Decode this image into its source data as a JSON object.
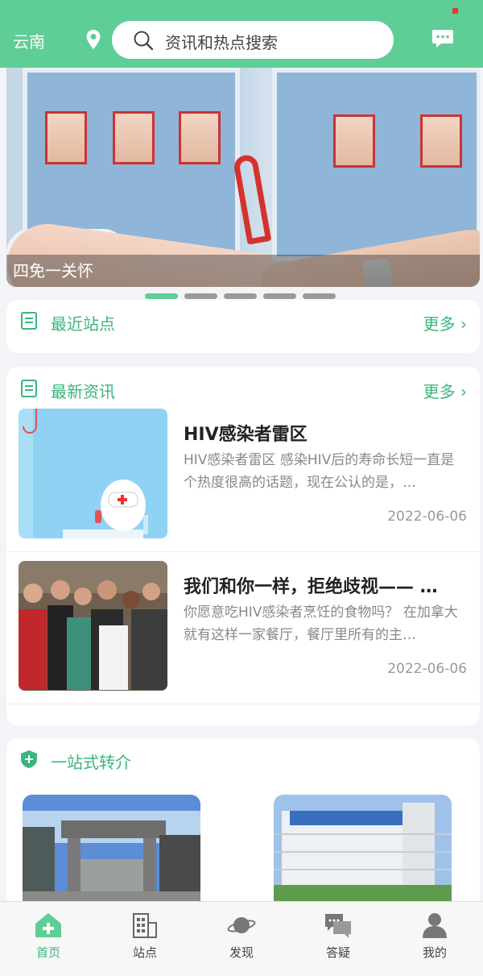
{
  "header": {
    "city": "云南",
    "search_placeholder": "资讯和热点搜索",
    "icons": [
      "location-pin-icon",
      "search-icon",
      "message-icon"
    ]
  },
  "banner": {
    "caption": "四免一关怀",
    "slides_total": 5,
    "active_index": 0
  },
  "recent_stations": {
    "title": "最近站点",
    "more": "更多"
  },
  "latest_news": {
    "title": "最新资讯",
    "more": "更多",
    "items": [
      {
        "title": "HIV感染者雷区",
        "desc": "HIV感染者雷区 感染HIV后的寿命长短一直是个热度很高的话题，现在公认的是，…",
        "date": "2022-06-06"
      },
      {
        "title": "我们和你一样，拒绝歧视—— …",
        "desc": "你愿意吃HIV感染者烹饪的食物吗？ 在加拿大就有这样一家餐厅，餐厅里所有的主…",
        "date": "2022-06-06"
      }
    ]
  },
  "referral": {
    "title": "一站式转介"
  },
  "tabbar": {
    "items": [
      {
        "label": "首页",
        "icon": "home-icon",
        "active": true
      },
      {
        "label": "站点",
        "icon": "building-icon",
        "active": false
      },
      {
        "label": "发现",
        "icon": "planet-icon",
        "active": false
      },
      {
        "label": "答疑",
        "icon": "chat-bubbles-icon",
        "active": false
      },
      {
        "label": "我的",
        "icon": "user-icon",
        "active": false
      }
    ]
  },
  "colors": {
    "brand": "#5fcd96",
    "accent_text": "#3ab57d"
  }
}
